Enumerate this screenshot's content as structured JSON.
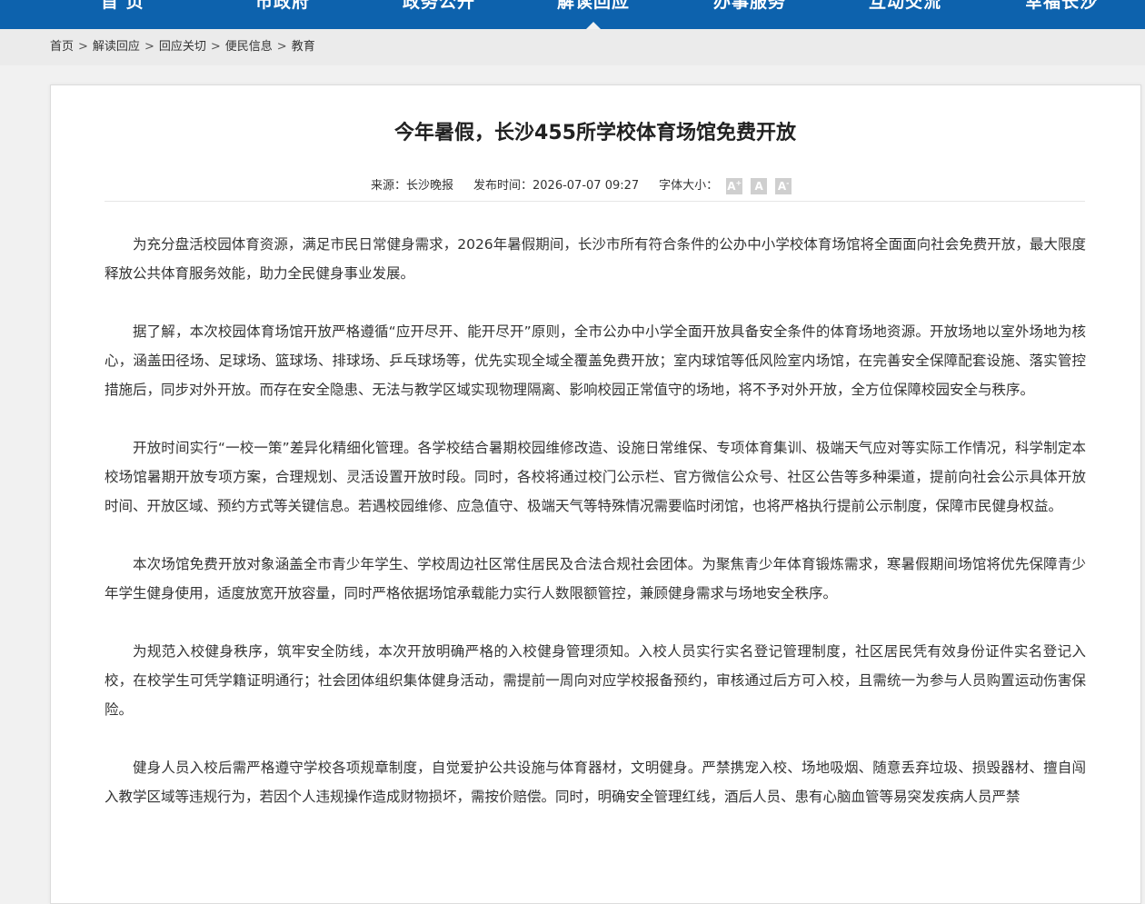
{
  "nav": {
    "items": [
      {
        "label": "首  页"
      },
      {
        "label": "市政府"
      },
      {
        "label": "政务公开"
      },
      {
        "label": "解读回应"
      },
      {
        "label": "办事服务"
      },
      {
        "label": "互动交流"
      },
      {
        "label": "幸福长沙"
      }
    ],
    "active": "解读回应"
  },
  "breadcrumb": {
    "items": [
      "首页",
      "解读回应",
      "回应关切",
      "便民信息",
      "教育"
    ],
    "separator": ">"
  },
  "article": {
    "title": "今年暑假，长沙455所学校体育场馆免费开放",
    "source_label": "来源：长沙晚报",
    "date_label": "发布时间：2026-07-07 09:27",
    "font_size_label": "字体大小：",
    "font_buttons": [
      "A",
      "A",
      "A"
    ],
    "paragraphs": [
      "为充分盘活校园体育资源，满足市民日常健身需求，2026年暑假期间，长沙市所有符合条件的公办中小学校体育场馆将全面面向社会免费开放，最大限度释放公共体育服务效能，助力全民健身事业发展。",
      "据了解，本次校园体育场馆开放严格遵循“应开尽开、能开尽开”原则，全市公办中小学全面开放具备安全条件的体育场地资源。开放场地以室外场地为核心，涵盖田径场、足球场、篮球场、排球场、乒乓球场等，优先实现全域全覆盖免费开放；室内球馆等低风险室内场馆，在完善安全保障配套设施、落实管控措施后，同步对外开放。而存在安全隐患、无法与教学区域实现物理隔离、影响校园正常值守的场地，将不予对外开放，全方位保障校园安全与秩序。",
      "开放时间实行“一校一策”差异化精细化管理。各学校结合暑期校园维修改造、设施日常维保、专项体育集训、极端天气应对等实际工作情况，科学制定本校场馆暑期开放专项方案，合理规划、灵活设置开放时段。同时，各校将通过校门公示栏、官方微信公众号、社区公告等多种渠道，提前向社会公示具体开放时间、开放区域、预约方式等关键信息。若遇校园维修、应急值守、极端天气等特殊情况需要临时闭馆，也将严格执行提前公示制度，保障市民健身权益。",
      "本次场馆免费开放对象涵盖全市青少年学生、学校周边社区常住居民及合法合规社会团体。为聚焦青少年体育锻炼需求，寒暑假期间场馆将优先保障青少年学生健身使用，适度放宽开放容量，同时严格依据场馆承载能力实行人数限额管控，兼顾健身需求与场地安全秩序。",
      "为规范入校健身秩序，筑牢安全防线，本次开放明确严格的入校健身管理须知。入校人员实行实名登记管理制度，社区居民凭有效身份证件实名登记入校，在校学生可凭学籍证明通行；社会团体组织集体健身活动，需提前一周向对应学校报备预约，审核通过后方可入校，且需统一为参与人员购置运动伤害保险。",
      "健身人员入校后需严格遵守学校各项规章制度，自觉爱护公共设施与体育器材，文明健身。严禁携宠入校、场地吸烟、随意丢弃垃圾、损毁器材、擅自闯入教学区域等违规行为，若因个人违规操作造成财物损坏，需按价赔偿。同时，明确安全管理红线，酒后人员、患有心脑血管等易突发疾病人员严禁"
    ]
  }
}
